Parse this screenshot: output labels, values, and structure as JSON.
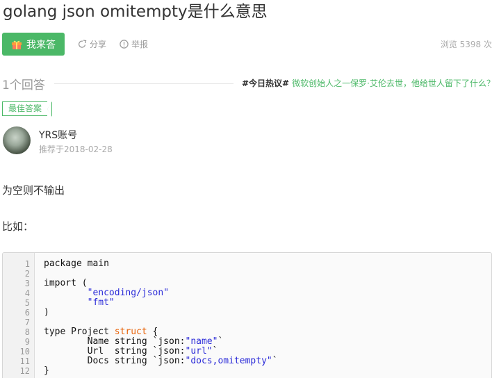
{
  "question": {
    "title": "golang json omitempty是什么意思"
  },
  "actions": {
    "answer_label": "我来答",
    "share_label": "分享",
    "report_label": "举报",
    "views_text": "浏览 5398 次"
  },
  "answers_header": {
    "count_text": "1个回答",
    "hot_tag": "#今日热议#",
    "hot_link": "微软创始人之一保罗·艾伦去世，他给世人留下了什么？"
  },
  "best_answer": {
    "badge": "最佳答案",
    "author": "YRS账号",
    "date_text": "推荐于2018-02-28",
    "paragraphs": [
      "为空则不输出",
      "比如："
    ]
  },
  "code": {
    "line_numbers": [
      "1",
      "2",
      "3",
      "4",
      "5",
      "6",
      "7",
      "8",
      "9",
      "10",
      "11",
      "12"
    ],
    "lines": [
      [
        {
          "t": "package main",
          "c": ""
        }
      ],
      [],
      [
        {
          "t": "import (",
          "c": ""
        }
      ],
      [
        {
          "t": "        ",
          "c": ""
        },
        {
          "t": "\"encoding/json\"",
          "c": "str"
        }
      ],
      [
        {
          "t": "        ",
          "c": ""
        },
        {
          "t": "\"fmt\"",
          "c": "str"
        }
      ],
      [
        {
          "t": ")",
          "c": ""
        }
      ],
      [],
      [
        {
          "t": "type Project ",
          "c": ""
        },
        {
          "t": "struct",
          "c": "kw"
        },
        {
          "t": " {",
          "c": ""
        }
      ],
      [
        {
          "t": "        Name string `json:",
          "c": ""
        },
        {
          "t": "\"name\"",
          "c": "str"
        },
        {
          "t": "`",
          "c": ""
        }
      ],
      [
        {
          "t": "        Url  string `json:",
          "c": ""
        },
        {
          "t": "\"url\"",
          "c": "str"
        },
        {
          "t": "`",
          "c": ""
        }
      ],
      [
        {
          "t": "        Docs string `json:",
          "c": ""
        },
        {
          "t": "\"docs,omitempty\"",
          "c": "str"
        },
        {
          "t": "`",
          "c": ""
        }
      ],
      [
        {
          "t": "}",
          "c": ""
        }
      ]
    ]
  },
  "colors": {
    "accent": "#4bb867",
    "string": "#2a2ad8",
    "keyword": "#e8630a"
  }
}
